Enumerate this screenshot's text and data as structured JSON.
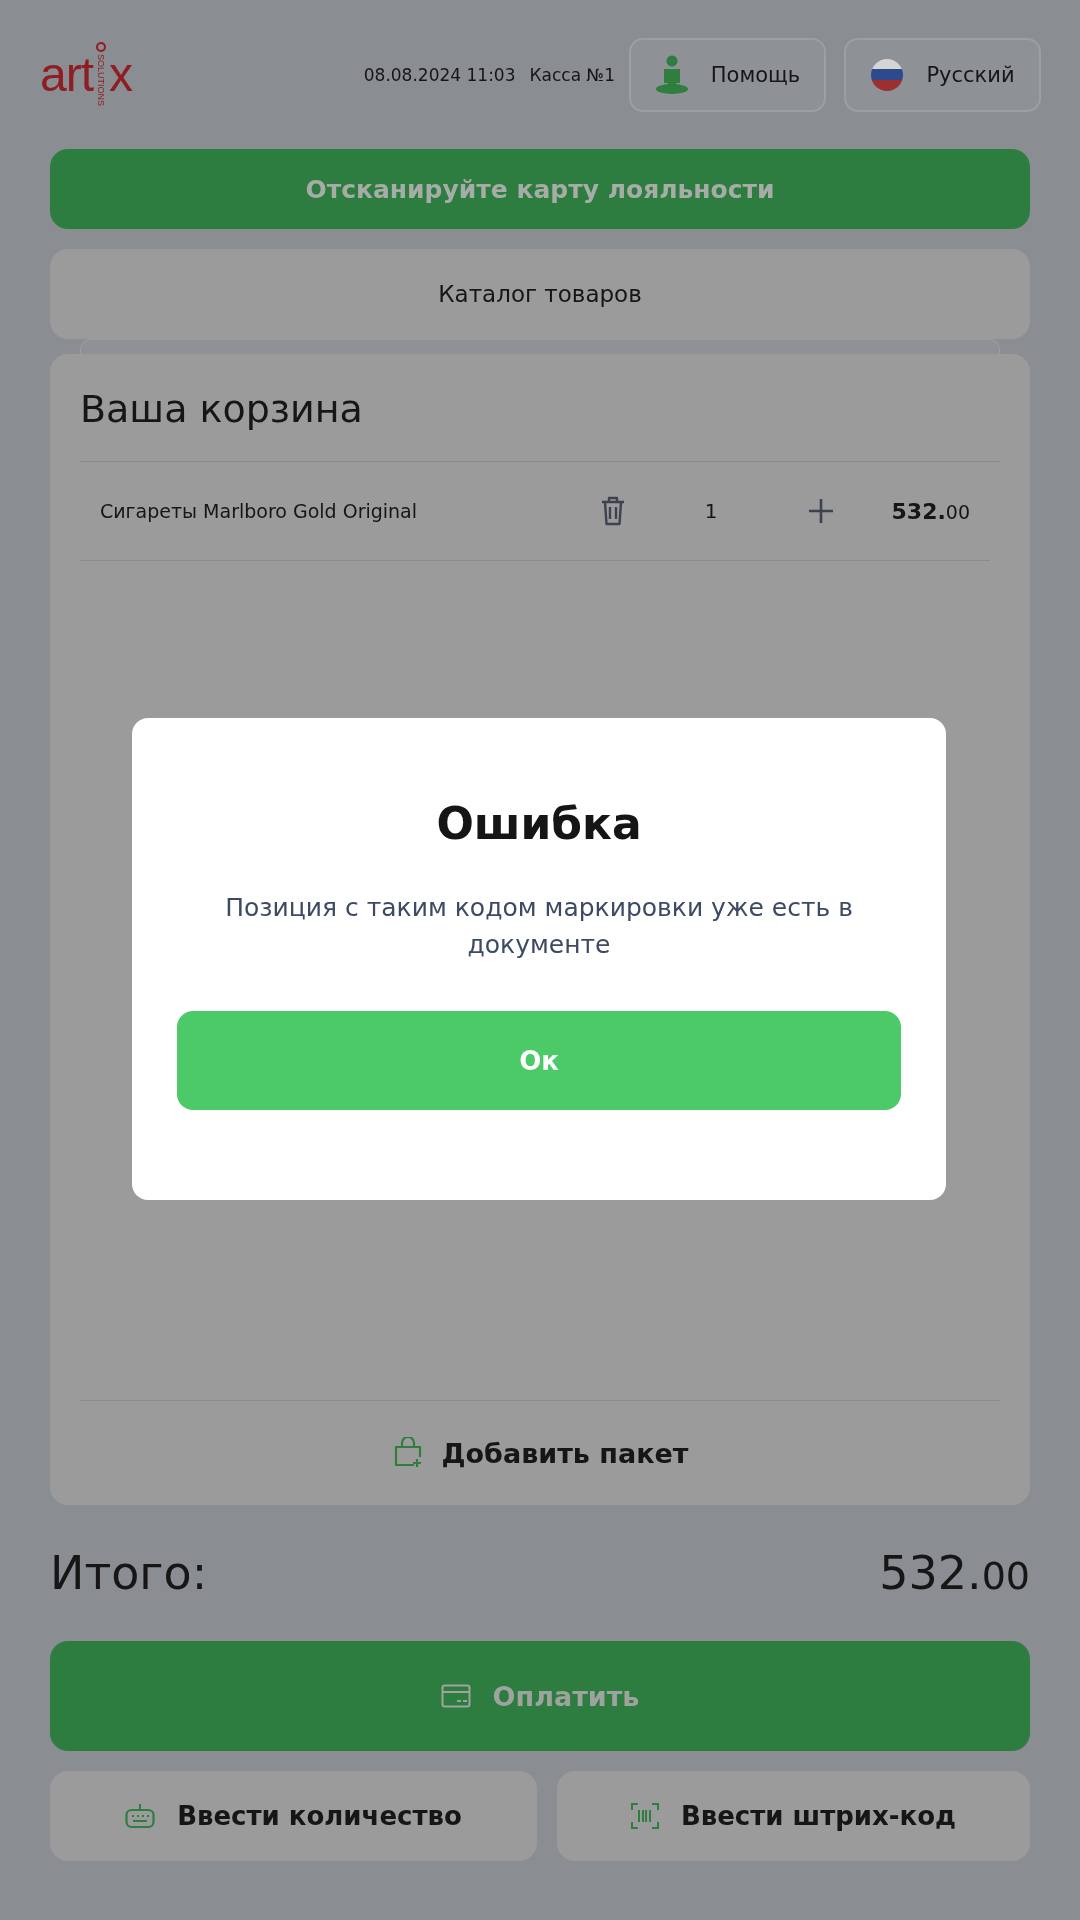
{
  "header": {
    "logo": {
      "text": "art",
      "accent": "x",
      "tagline": "SOLUTIONS"
    },
    "datetime": "08.08.2024 11:03",
    "register": "Касса №1",
    "help_button": "Помощь",
    "language_button": "Русский"
  },
  "loyalty_banner": "Отсканируйте карту лояльности",
  "catalog_button": "Каталог товаров",
  "cart": {
    "title": "Ваша корзина",
    "items": [
      {
        "name": "Сигареты Marlboro Gold Original",
        "quantity": "1",
        "price": "**532.**00"
      }
    ],
    "add_bag": "Добавить пакет"
  },
  "total": {
    "label": "Итого:",
    "amount": "532.00"
  },
  "pay_button": "Оплатить",
  "bottom_buttons": [
    {
      "kind": "keypad",
      "label": "Ввести количество"
    },
    {
      "kind": "barcode",
      "label": "Ввести штрих-код"
    }
  ],
  "dialog": {
    "title": "Ошибка",
    "message": "Позиция с таким кодом маркировки уже есть в документе",
    "ok_button": "Ок"
  }
}
